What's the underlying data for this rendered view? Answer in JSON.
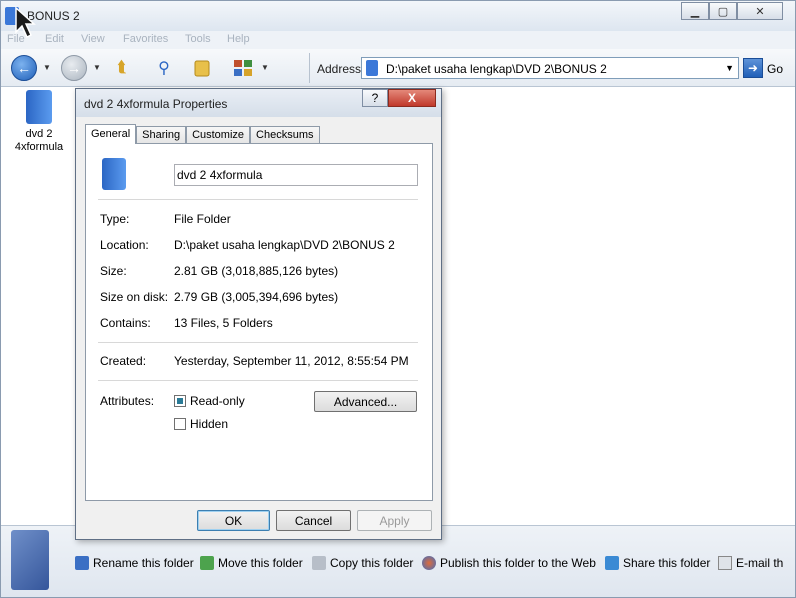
{
  "explorer": {
    "title": "BONUS 2",
    "menu": [
      "File",
      "Edit",
      "View",
      "Favorites",
      "Tools",
      "Help"
    ],
    "address_label": "Address",
    "address_value": "D:\\paket usaha lengkap\\DVD 2\\BONUS 2",
    "go_label": "Go",
    "items": [
      {
        "name": "dvd 2 4xformula"
      }
    ],
    "tasks": [
      {
        "label": "Rename this folder",
        "icon": "rename-icon"
      },
      {
        "label": "Move this folder",
        "icon": "move-icon"
      },
      {
        "label": "Copy this folder",
        "icon": "copy-icon"
      },
      {
        "label": "Publish this folder to the Web",
        "icon": "publish-icon"
      },
      {
        "label": "Share this folder",
        "icon": "share-icon"
      },
      {
        "label": "E-mail th",
        "icon": "email-icon"
      }
    ]
  },
  "dialog": {
    "title": "dvd 2 4xformula Properties",
    "help_glyph": "?",
    "close_glyph": "X",
    "tabs": [
      "General",
      "Sharing",
      "Customize",
      "Checksums"
    ],
    "name_value": "dvd 2 4xformula",
    "props": {
      "type_label": "Type:",
      "type_value": "File Folder",
      "location_label": "Location:",
      "location_value": "D:\\paket usaha lengkap\\DVD 2\\BONUS 2",
      "size_label": "Size:",
      "size_value": "2.81 GB (3,018,885,126 bytes)",
      "disk_label": "Size on disk:",
      "disk_value": "2.79 GB (3,005,394,696 bytes)",
      "contains_label": "Contains:",
      "contains_value": "13 Files, 5 Folders",
      "created_label": "Created:",
      "created_value": "Yesterday, September 11, 2012, 8:55:54 PM",
      "attributes_label": "Attributes:"
    },
    "attributes": {
      "readonly_label": "Read-only",
      "readonly_state": "indeterminate",
      "hidden_label": "Hidden",
      "hidden_state": "unchecked",
      "advanced_label": "Advanced..."
    },
    "buttons": {
      "ok": "OK",
      "cancel": "Cancel",
      "apply": "Apply"
    }
  },
  "colors": {
    "accent": "#3b78d8",
    "close_red": "#c0392b",
    "window_border": "#8a9bb0"
  }
}
